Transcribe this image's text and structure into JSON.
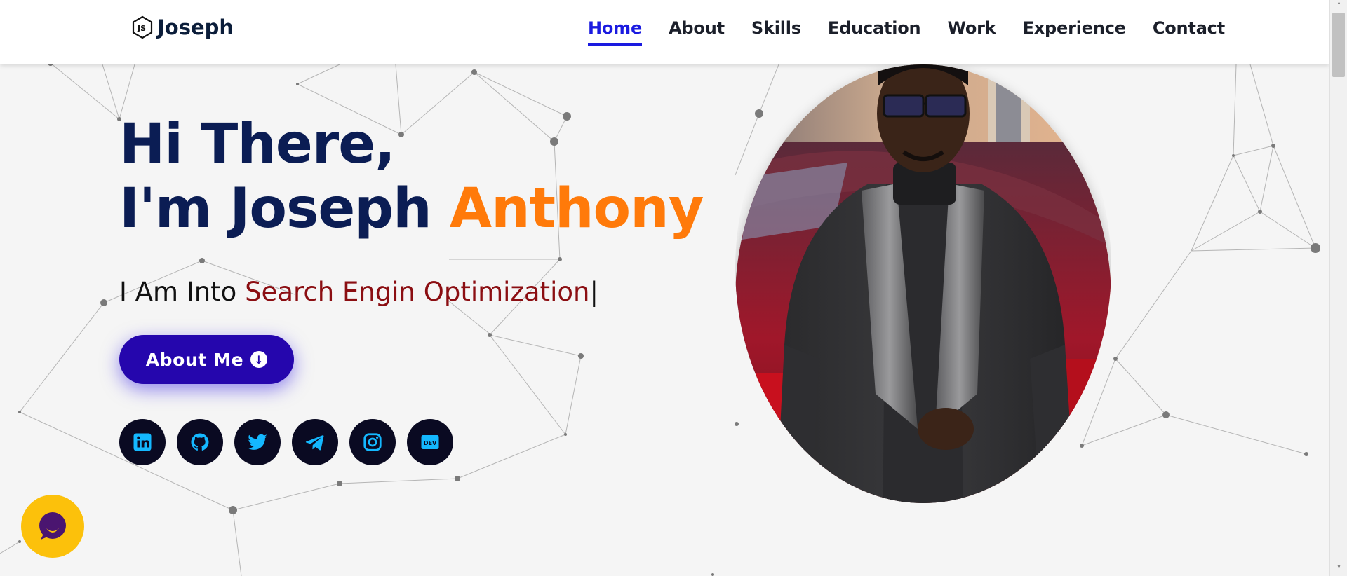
{
  "logo": {
    "text": "Joseph",
    "icon": "nodejs-hexagon-icon"
  },
  "nav": {
    "items": [
      {
        "label": "Home",
        "active": true
      },
      {
        "label": "About",
        "active": false
      },
      {
        "label": "Skills",
        "active": false
      },
      {
        "label": "Education",
        "active": false
      },
      {
        "label": "Work",
        "active": false
      },
      {
        "label": "Experience",
        "active": false
      },
      {
        "label": "Contact",
        "active": false
      }
    ]
  },
  "hero": {
    "greeting": "Hi There,",
    "name_prefix": "I'm Joseph ",
    "name_accent": "Anthony",
    "typed_prefix": "I Am Into ",
    "typed_text": "Search Engin Optimization",
    "cursor": "|",
    "cta_label": "About Me",
    "cta_icon": "arrow-circle-down-icon"
  },
  "socials": [
    {
      "name": "linkedin-icon"
    },
    {
      "name": "github-icon"
    },
    {
      "name": "twitter-icon"
    },
    {
      "name": "telegram-icon"
    },
    {
      "name": "instagram-icon"
    },
    {
      "name": "dev-icon",
      "label": "DEV"
    }
  ],
  "colors": {
    "primary": "#2506ad",
    "accent": "#ff7a0a",
    "heading": "#0b1d54",
    "typed": "#8b0e12",
    "nav_active": "#1a1ae0",
    "social_icon": "#14b8ff",
    "chat": "#fcc10b"
  },
  "chat": {
    "icon": "chat-bubble-icon"
  }
}
